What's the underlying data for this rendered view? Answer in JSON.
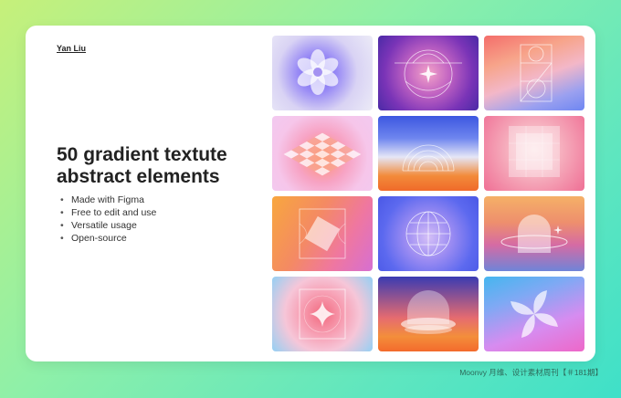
{
  "author": "Yan Liu",
  "title_lines": [
    "50 gradient textute",
    "abstract elements"
  ],
  "features": [
    "Made with Figma",
    "Free to edit and use",
    "Versatile usage",
    "Open-source"
  ],
  "tiles": [
    {
      "name": "swirl-flower",
      "icon": "swirl-flower-icon"
    },
    {
      "name": "circle-sparkle",
      "icon": "circle-star-icon"
    },
    {
      "name": "geometric-grid",
      "icon": "geometric-grid-icon"
    },
    {
      "name": "checker-plane",
      "icon": "checker-plane-icon"
    },
    {
      "name": "concentric-arcs",
      "icon": "concentric-arcs-icon"
    },
    {
      "name": "nested-squares",
      "icon": "nested-squares-icon"
    },
    {
      "name": "rotated-square",
      "icon": "rotated-square-icon"
    },
    {
      "name": "wireframe-globe",
      "icon": "globe-icon"
    },
    {
      "name": "planet-ring",
      "icon": "planet-ring-icon"
    },
    {
      "name": "four-point-star",
      "icon": "four-point-star-icon"
    },
    {
      "name": "dome",
      "icon": "dome-icon"
    },
    {
      "name": "pinwheel",
      "icon": "pinwheel-icon"
    }
  ],
  "footer": "Moonvy 月维、设计素材周刊【＃181期】"
}
